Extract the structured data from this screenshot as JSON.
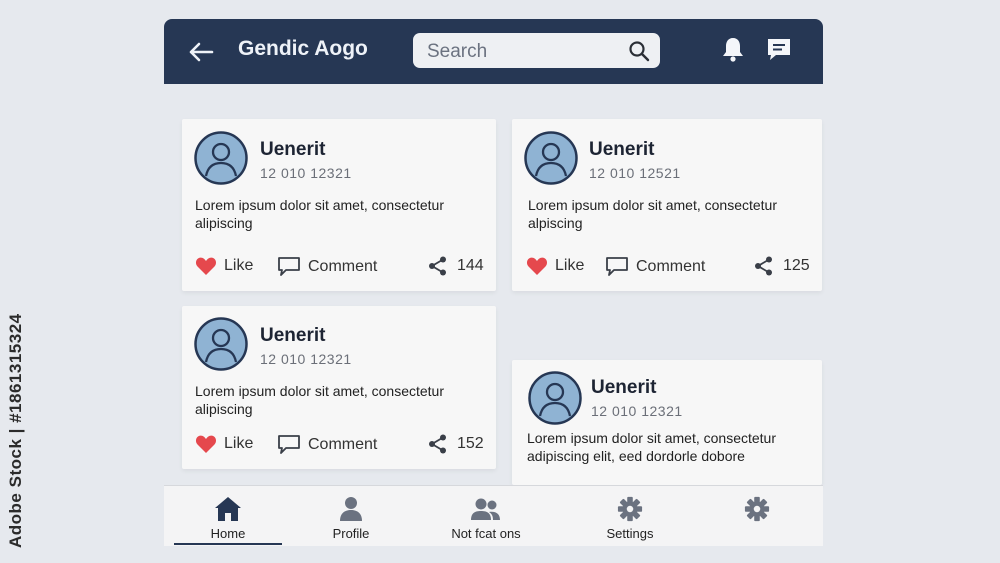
{
  "watermark": "Adobe Stock | #1861315324",
  "header": {
    "title": "Gendic Aogo",
    "search_placeholder": "Search"
  },
  "posts": [
    {
      "username": "Uenerit",
      "timestamp": "12 010 12321",
      "text_line1": "Lorem ipsum dolor sit amet, consectetur",
      "text_line2": "alipiscing",
      "like_label": "Like",
      "comment_label": "Comment",
      "share_count": "144"
    },
    {
      "username": "Uenerit",
      "timestamp": "12 010 12521",
      "text_line1": "Lorem ipsum dolor sit amet, consectetur",
      "text_line2": "alpiscing",
      "like_label": "Like",
      "comment_label": "Comment",
      "share_count": "125"
    },
    {
      "username": "Uenerit",
      "timestamp": "12 010 12321",
      "text_line1": "Lorem ipsum dolor sit amet, consectetur",
      "text_line2": "alipiscing",
      "like_label": "Like",
      "comment_label": "Comment",
      "share_count": "152"
    },
    {
      "username": "Uenerit",
      "timestamp": "12 010 12321",
      "text_line1": "Lorem ipsum dolor sit amet, consectetur",
      "text_line2": "adipiscing elit, eed dordorle dobore"
    }
  ],
  "nav": {
    "items": [
      {
        "label": "Home",
        "icon": "home-icon"
      },
      {
        "label": "Profile",
        "icon": "user-icon"
      },
      {
        "label": "Not fcat ons",
        "icon": "users-icon"
      },
      {
        "label": "Settings",
        "icon": "gear-icon"
      },
      {
        "label": "",
        "icon": "gear-icon"
      }
    ]
  },
  "colors": {
    "header_bg": "#263754",
    "avatar_fill": "#8fb3d3",
    "heart": "#e5484d",
    "page_bg": "#e6e9ee"
  }
}
